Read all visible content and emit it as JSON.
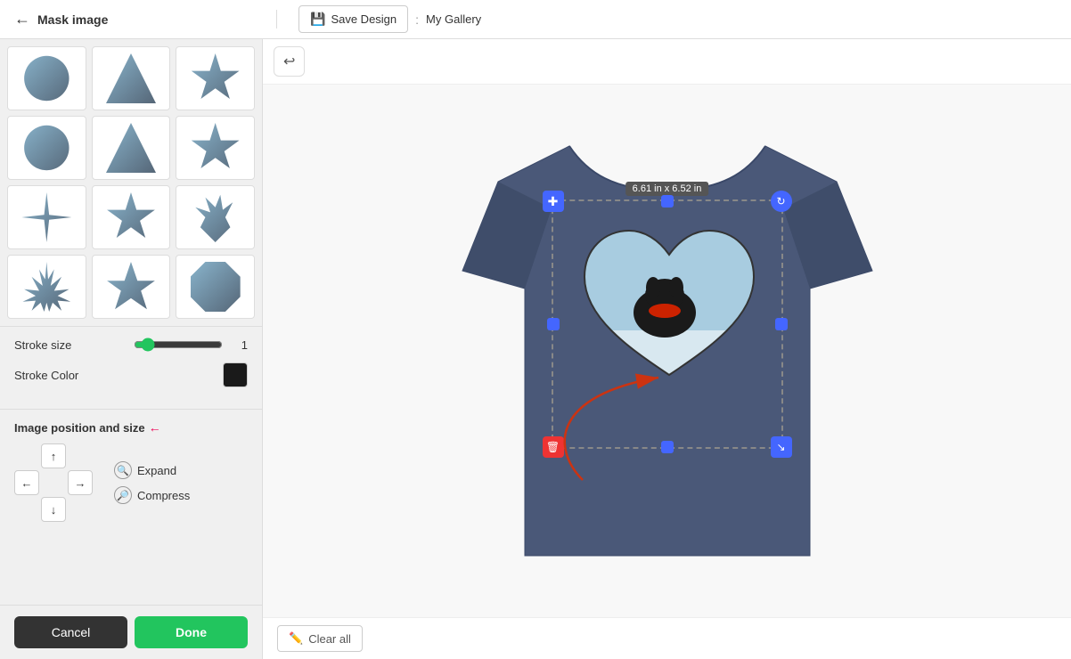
{
  "header": {
    "title": "Mask image",
    "back_label": "←",
    "save_design_label": "Save Design",
    "divider": ":",
    "my_gallery_label": "My Gallery"
  },
  "sidebar": {
    "stroke_size_label": "Stroke size",
    "stroke_size_value": "1",
    "stroke_color_label": "Stroke Color",
    "position_title": "Image position and size",
    "expand_label": "Expand",
    "compress_label": "Compress",
    "cancel_label": "Cancel",
    "done_label": "Done"
  },
  "canvas": {
    "size_label": "6.61 in x 6.52 in",
    "undo_label": "↩",
    "clear_all_label": "Clear all"
  },
  "masks": [
    {
      "id": "m1",
      "shape": "circle"
    },
    {
      "id": "m2",
      "shape": "triangle"
    },
    {
      "id": "m3",
      "shape": "star6"
    },
    {
      "id": "m4",
      "shape": "star4"
    },
    {
      "id": "m5",
      "shape": "star5"
    },
    {
      "id": "m6",
      "shape": "flame"
    },
    {
      "id": "m7",
      "shape": "burst"
    },
    {
      "id": "m8",
      "shape": "star5b"
    },
    {
      "id": "m9",
      "shape": "badge"
    }
  ],
  "colors": {
    "accent_green": "#22c55e",
    "stroke_color": "#1a1a1a",
    "handle_blue": "#4466ff",
    "delete_red": "#dd3333",
    "tshirt_body": "#4a5878",
    "arrow_red": "#cc3311"
  }
}
